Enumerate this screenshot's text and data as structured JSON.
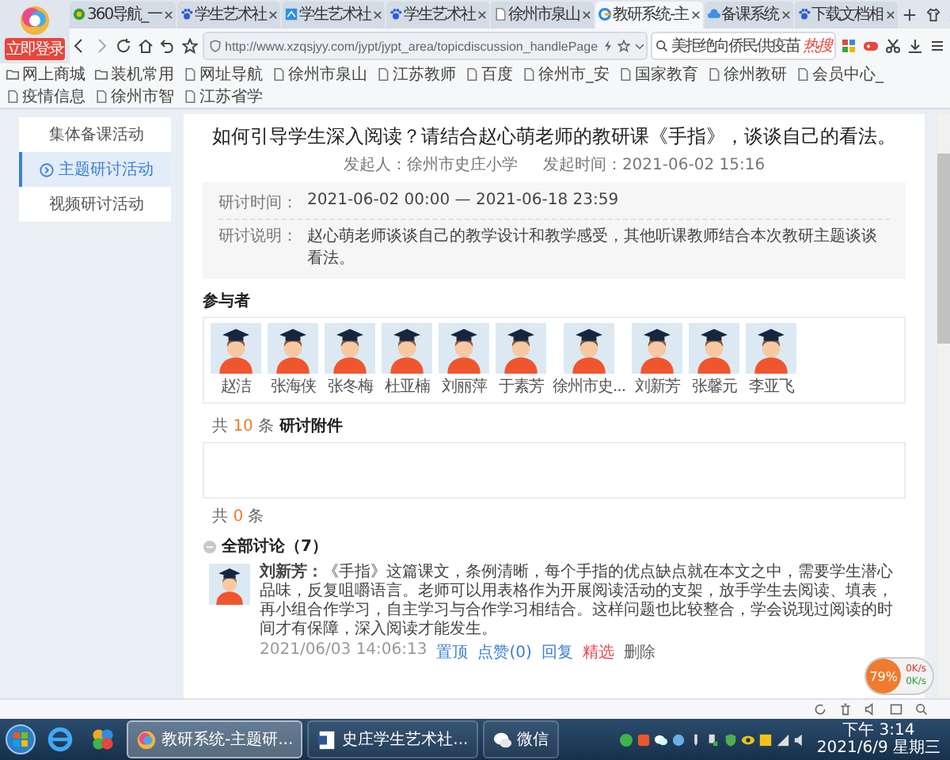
{
  "browser": {
    "login_badge": "立即登录",
    "tabs": [
      {
        "title": "360导航_一",
        "selected": false
      },
      {
        "title": "学生艺术社",
        "selected": false
      },
      {
        "title": "学生艺术社",
        "selected": false
      },
      {
        "title": "学生艺术社",
        "selected": false
      },
      {
        "title": "徐州市泉山",
        "selected": false
      },
      {
        "title": "教研系统-主",
        "selected": true
      },
      {
        "title": "备课系统",
        "selected": false
      },
      {
        "title": "下载文档相",
        "selected": false
      }
    ],
    "address": "http://www.xzqsjyy.com/jypt/jypt_area/topicdiscussion_handlePage",
    "search": {
      "value": "美拒绝向侨民供疫苗",
      "hot_label": "热搜"
    },
    "bookmarks": [
      "网上商城",
      "装机常用",
      "网址导航",
      "徐州市泉山",
      "江苏教师",
      "百度",
      "徐州市_安",
      "国家教育",
      "徐州教研",
      "会员中心_",
      "疫情信息",
      "徐州市智",
      "江苏省学"
    ]
  },
  "sidebar": {
    "items": [
      {
        "label": "集体备课活动",
        "selected": false
      },
      {
        "label": "主题研讨活动",
        "selected": true
      },
      {
        "label": "视频研讨活动",
        "selected": false
      }
    ]
  },
  "topic": {
    "title": "如何引导学生深入阅读？请结合赵心萌老师的教研课《手指》，谈谈自己的看法。",
    "initiator": "发起人：徐州市史庄小学",
    "start_time": "发起时间：2021-06-02 15:16",
    "details": [
      {
        "label": "研讨时间：",
        "value": "2021-06-02 00:00 — 2021-06-18 23:59"
      },
      {
        "label": "研讨说明：",
        "value": "赵心萌老师谈谈自己的教学设计和教学感受，其他听课教师结合本次教研主题谈谈看法。"
      }
    ]
  },
  "participants": {
    "heading": "参与者",
    "people": [
      "赵洁",
      "张海侠",
      "张冬梅",
      "杜亚楠",
      "刘丽萍",
      "于素芳",
      "徐州市史...",
      "刘新芳",
      "张馨元",
      "李亚飞"
    ],
    "total": {
      "prefix": "共",
      "count": "10",
      "suffix": "条"
    }
  },
  "attachments": {
    "heading": "研讨附件",
    "total": {
      "prefix": "共",
      "count": "0",
      "suffix": "条"
    }
  },
  "discussion": {
    "heading": "全部讨论（7）",
    "comments": [
      {
        "text": "**刘新芳：**《手指》这篇课文，条例清晰，每个手指的优点缺点就在本文之中，需要学生潜心品味，反复咀嚼语言。老师可以用表格作为开展阅读活动的支架，放手学生去阅读、填表，再小组合作学习，自主学习与合作学习相结合。这样问题也比较整合，学会说现过阅读的时间才有保障，深入阅读才能发生。",
        "time": "2021/06/03 14:06:13",
        "actions": [
          {
            "label": "置顶",
            "color": "#3a7fd5"
          },
          {
            "label": "点赞(0)",
            "color": "#3a7fd5"
          },
          {
            "label": "回复",
            "color": "#3a7fd5"
          },
          {
            "label": "精选",
            "color": "#e8464a"
          },
          {
            "label": "删除",
            "color": "#666666"
          }
        ]
      }
    ]
  },
  "network_widget": {
    "usage": "79%",
    "upload": "0K/s",
    "download": "0K/s"
  },
  "taskbar": {
    "tasks": [
      {
        "label": "教研系统-主题研...",
        "selected": true
      },
      {
        "label": "史庄学生艺术社...",
        "selected": false
      },
      {
        "label": "微信",
        "selected": false
      }
    ],
    "clock": {
      "time": "下午 3:14",
      "date": "2021/6/9 星期三"
    }
  }
}
